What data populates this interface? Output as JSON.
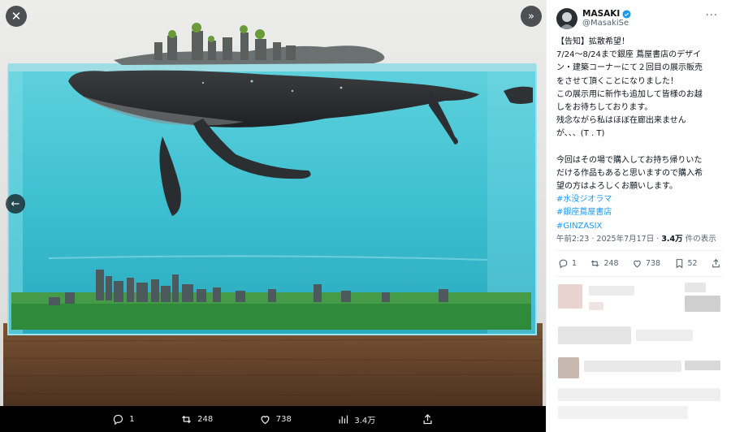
{
  "viewer": {
    "actions": [
      {
        "icon": "reply-icon",
        "count": "1"
      },
      {
        "icon": "repost-icon",
        "count": "248"
      },
      {
        "icon": "like-icon",
        "count": "738"
      },
      {
        "icon": "views-icon",
        "count": "3.4万"
      },
      {
        "icon": "share-icon",
        "count": ""
      }
    ]
  },
  "post": {
    "display_name": "MASAKI",
    "handle": "@MasakiSe",
    "lines": [
      "【告知】拡散希望！",
      "7/24〜8/24まで銀座 蔦屋書店のデザイ",
      "ン・建築コーナーにて２回目の展示販売",
      "をさせて頂くことになりました！",
      "この展示用に新作も追加して皆様のお越",
      "しをお待ちしております。",
      "残念ながら私はほぼ在廊出来ません",
      "が、、、(T . T)",
      "",
      "今回はその場で購入してお持ち帰りいた",
      "だける作品もあると思いますので購入希",
      "望の方はよろしくお願いします。"
    ],
    "hashtags": [
      "#水没ジオラマ",
      "#銀座蔦屋書店",
      "#GINZASIX"
    ],
    "time": "午前2:23",
    "date": "2025年7月17日",
    "views_count": "3.4万",
    "views_label": "件の表示",
    "stats": {
      "replies": "1",
      "reposts": "248",
      "likes": "738",
      "bookmarks": "52"
    }
  },
  "colors": {
    "accent": "#1d9bf0",
    "water": "#3fc0d2",
    "verified": "#1d9bf0"
  }
}
